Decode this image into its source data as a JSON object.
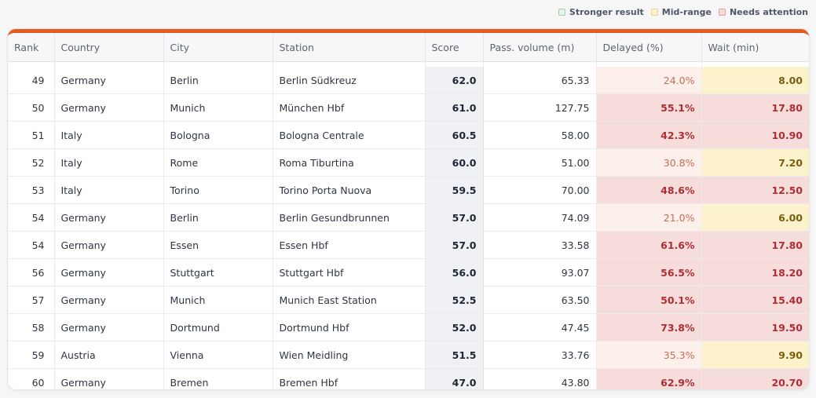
{
  "legend": {
    "good": "Stronger result",
    "mid": "Mid-range",
    "bad": "Needs attention"
  },
  "colors": {
    "accent": "#e45a20",
    "good": "#e4f3ea",
    "mid": "#fdf3cf",
    "bad": "#f7dcdc"
  },
  "table": {
    "headers": [
      "Rank",
      "Country",
      "City",
      "Station",
      "Score",
      "Pass. volume (m)",
      "Delayed (%)",
      "Wait (min)"
    ],
    "rows": [
      {
        "rank": "49",
        "country": "Germany",
        "city": "Berlin",
        "station": "Berlin Südkreuz",
        "score": "62.0",
        "pass": "65.33",
        "delay": "24.0%",
        "wait": "8.00",
        "level": "mid"
      },
      {
        "rank": "50",
        "country": "Germany",
        "city": "Munich",
        "station": "München Hbf",
        "score": "61.0",
        "pass": "127.75",
        "delay": "55.1%",
        "wait": "17.80",
        "level": "bad"
      },
      {
        "rank": "51",
        "country": "Italy",
        "city": "Bologna",
        "station": "Bologna Centrale",
        "score": "60.5",
        "pass": "58.00",
        "delay": "42.3%",
        "wait": "10.90",
        "level": "bad"
      },
      {
        "rank": "52",
        "country": "Italy",
        "city": "Rome",
        "station": "Roma Tiburtina",
        "score": "60.0",
        "pass": "51.00",
        "delay": "30.8%",
        "wait": "7.20",
        "level": "mid"
      },
      {
        "rank": "53",
        "country": "Italy",
        "city": "Torino",
        "station": "Torino Porta Nuova",
        "score": "59.5",
        "pass": "70.00",
        "delay": "48.6%",
        "wait": "12.50",
        "level": "bad"
      },
      {
        "rank": "54",
        "country": "Germany",
        "city": "Berlin",
        "station": "Berlin Gesundbrunnen",
        "score": "57.0",
        "pass": "74.09",
        "delay": "21.0%",
        "wait": "6.00",
        "level": "mid"
      },
      {
        "rank": "54",
        "country": "Germany",
        "city": "Essen",
        "station": "Essen Hbf",
        "score": "57.0",
        "pass": "33.58",
        "delay": "61.6%",
        "wait": "17.80",
        "level": "bad"
      },
      {
        "rank": "56",
        "country": "Germany",
        "city": "Stuttgart",
        "station": "Stuttgart Hbf",
        "score": "56.0",
        "pass": "93.07",
        "delay": "56.5%",
        "wait": "18.20",
        "level": "bad"
      },
      {
        "rank": "57",
        "country": "Germany",
        "city": "Munich",
        "station": "Munich East Station",
        "score": "52.5",
        "pass": "63.50",
        "delay": "50.1%",
        "wait": "15.40",
        "level": "bad"
      },
      {
        "rank": "58",
        "country": "Germany",
        "city": "Dortmund",
        "station": "Dortmund Hbf",
        "score": "52.0",
        "pass": "47.45",
        "delay": "73.8%",
        "wait": "19.50",
        "level": "bad"
      },
      {
        "rank": "59",
        "country": "Austria",
        "city": "Vienna",
        "station": "Wien Meidling",
        "score": "51.5",
        "pass": "33.76",
        "delay": "35.3%",
        "wait": "9.90",
        "level": "mid"
      },
      {
        "rank": "60",
        "country": "Germany",
        "city": "Bremen",
        "station": "Bremen Hbf",
        "score": "47.0",
        "pass": "43.80",
        "delay": "62.9%",
        "wait": "20.70",
        "level": "bad"
      }
    ]
  }
}
